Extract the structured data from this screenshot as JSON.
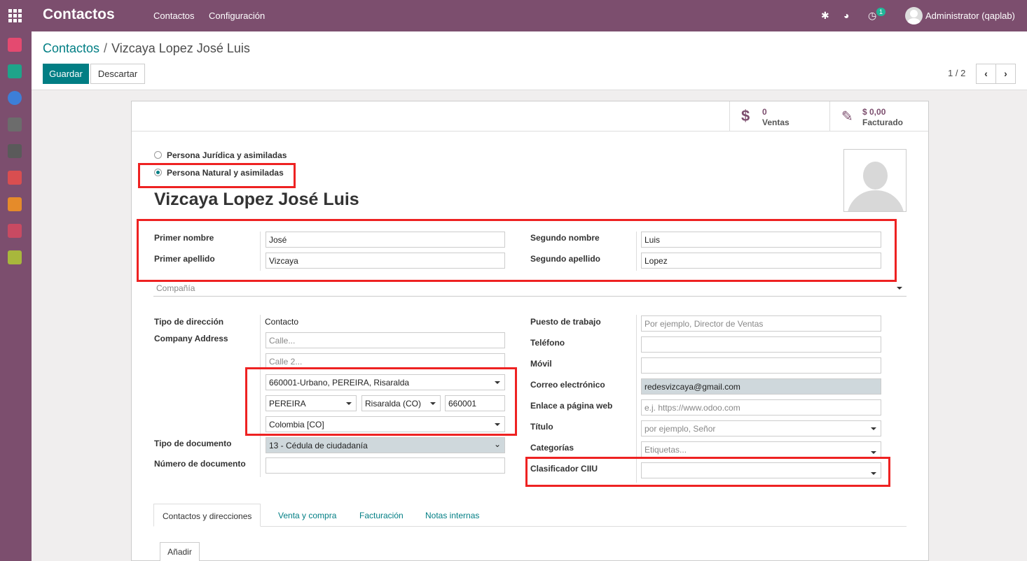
{
  "navbar": {
    "brand": "Contactos",
    "menu": [
      "Contactos",
      "Configuración"
    ],
    "activity_count": "1",
    "user": "Administrator (qaplab)"
  },
  "sidebar_icons": [
    "discuss-icon",
    "contacts-icon",
    "website-icon",
    "pos-icon",
    "link-icon",
    "inventory-icon",
    "document-icon",
    "apps-icon",
    "settings-icon"
  ],
  "breadcrumb": {
    "root": "Contactos",
    "separator": "/",
    "current": "Vizcaya Lopez José Luis"
  },
  "actions": {
    "save": "Guardar",
    "discard": "Descartar"
  },
  "pager": {
    "text": "1 / 2",
    "prev": "‹",
    "next": "›"
  },
  "smart_buttons": [
    {
      "icon": "$",
      "value": "0",
      "label": "Ventas"
    },
    {
      "icon": "✎",
      "value": "$ 0,00",
      "label": "Facturado"
    }
  ],
  "person_type": {
    "options": [
      "Persona Jurídica y asimiladas",
      "Persona Natural y asimiladas"
    ],
    "selected": "Persona Natural y asimiladas"
  },
  "title": "Vizcaya Lopez José Luis",
  "names": {
    "primer_nombre_label": "Primer nombre",
    "primer_nombre": "José",
    "segundo_nombre_label": "Segundo nombre",
    "segundo_nombre": "Luis",
    "primer_apellido_label": "Primer apellido",
    "primer_apellido": "Vizcaya",
    "segundo_apellido_label": "Segundo apellido",
    "segundo_apellido": "Lopez"
  },
  "company_placeholder": "Compañía",
  "left": {
    "tipo_direccion_label": "Tipo de dirección",
    "tipo_direccion": "Contacto",
    "company_address_label": "Company Address",
    "street_placeholder": "Calle...",
    "street2_placeholder": "Calle 2...",
    "postal_combo": "660001-Urbano, PEREIRA, Risaralda",
    "city": "PEREIRA",
    "state": "Risaralda (CO)",
    "zip": "660001",
    "country": "Colombia [CO]",
    "tipo_documento_label": "Tipo de documento",
    "tipo_documento": "13 - Cédula de ciudadanía",
    "numero_documento_label": "Número de documento",
    "numero_documento": ""
  },
  "right": {
    "puesto_label": "Puesto de trabajo",
    "puesto_placeholder": "Por ejemplo, Director de Ventas",
    "telefono_label": "Teléfono",
    "movil_label": "Móvil",
    "correo_label": "Correo electrónico",
    "correo": "redesvizcaya@gmail.com",
    "web_label": "Enlace a página web",
    "web_placeholder": "e.j. https://www.odoo.com",
    "titulo_label": "Título",
    "titulo_placeholder": "por ejemplo, Señor",
    "categorias_label": "Categorías",
    "categorias_placeholder": "Etiquetas...",
    "ciiu_label": "Clasificador CIIU",
    "ciiu": ""
  },
  "tabs": [
    "Contactos y direcciones",
    "Venta y compra",
    "Facturación",
    "Notas internas"
  ],
  "add_button": "Añadir",
  "colors": {
    "navbar": "#7c4e6e",
    "primary": "#017e84",
    "highlight_box": "#ee2222"
  }
}
